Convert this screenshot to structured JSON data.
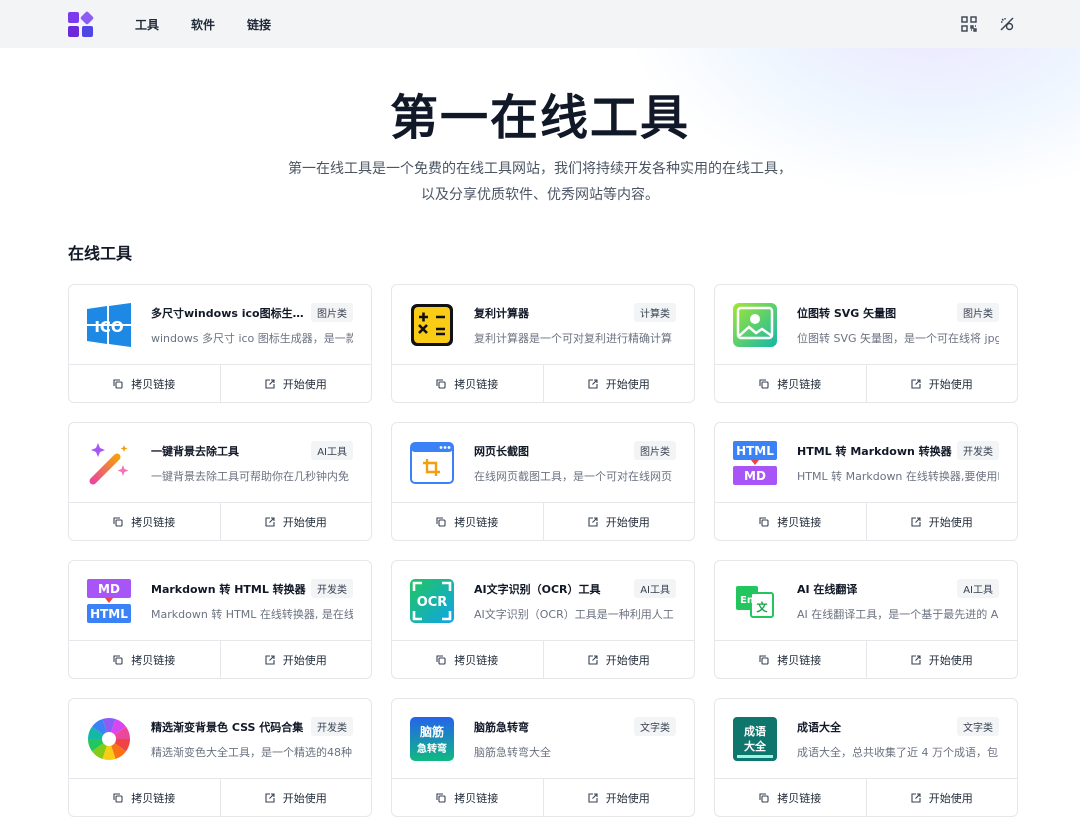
{
  "nav": {
    "items": [
      "工具",
      "软件",
      "链接"
    ]
  },
  "hero": {
    "title": "第一在线工具",
    "desc_line1": "第一在线工具是一个免费的在线工具网站，我们将持续开发各种实用的在线工具，",
    "desc_line2": "以及分享优质软件、优秀网站等内容。"
  },
  "section": {
    "title": "在线工具"
  },
  "buttons": {
    "copy": "拷贝链接",
    "open": "开始使用"
  },
  "icons": {
    "copy": "copy-icon",
    "open": "external-link-icon",
    "qr": "qr-code-icon",
    "theme": "theme-toggle-icon"
  },
  "cards": [
    {
      "name": "多尺寸windows ico图标生成...",
      "tag": "图片类",
      "desc": "windows 多尺寸 ico 图标生成器，是一款",
      "icon": "windows-ico-icon"
    },
    {
      "name": "复利计算器",
      "tag": "计算类",
      "desc": "复利计算器是一个可对复利进行精确计算",
      "icon": "calculator-icon"
    },
    {
      "name": "位图转 SVG 矢量图",
      "tag": "图片类",
      "desc": "位图转 SVG 矢量图，是一个可在线将 jpg",
      "icon": "image-icon"
    },
    {
      "name": "一键背景去除工具",
      "tag": "AI工具",
      "desc": "一键背景去除工具可帮助你在几秒钟内免",
      "icon": "magic-wand-icon"
    },
    {
      "name": "网页长截图",
      "tag": "图片类",
      "desc": "在线网页截图工具，是一个可对在线网页",
      "icon": "screenshot-icon"
    },
    {
      "name": "HTML 转 Markdown 转换器",
      "tag": "开发类",
      "desc": "HTML 转 Markdown 在线转换器,要使用H",
      "icon": "html-to-md-icon",
      "badge_top": "HTML",
      "badge_bottom": "MD"
    },
    {
      "name": "Markdown 转 HTML 转换器",
      "tag": "开发类",
      "desc": "Markdown 转 HTML 在线转换器, 是在线",
      "icon": "md-to-html-icon",
      "badge_top": "MD",
      "badge_bottom": "HTML"
    },
    {
      "name": "AI文字识别（OCR）工具",
      "tag": "AI工具",
      "desc": "AI文字识别（OCR）工具是一种利用人工",
      "icon": "ocr-icon",
      "badge_top": "OCR"
    },
    {
      "name": "AI 在线翻译",
      "tag": "AI工具",
      "desc": "AI 在线翻译工具，是一个基于最先进的 A",
      "icon": "translate-icon",
      "badge_top": "En",
      "badge_bottom": "文"
    },
    {
      "name": "精选渐变背景色 CSS 代码合集",
      "tag": "开发类",
      "desc": "精选渐变色大全工具，是一个精选的48种",
      "icon": "color-wheel-icon"
    },
    {
      "name": "脑筋急转弯",
      "tag": "文字类",
      "desc": "脑筋急转弯大全",
      "icon": "brain-teaser-icon",
      "badge_top": "脑筋",
      "badge_bottom": "急转弯"
    },
    {
      "name": "成语大全",
      "tag": "文字类",
      "desc": "成语大全，总共收集了近 4 万个成语，包",
      "icon": "idiom-book-icon",
      "badge_top": "成语",
      "badge_bottom": "大全"
    }
  ]
}
